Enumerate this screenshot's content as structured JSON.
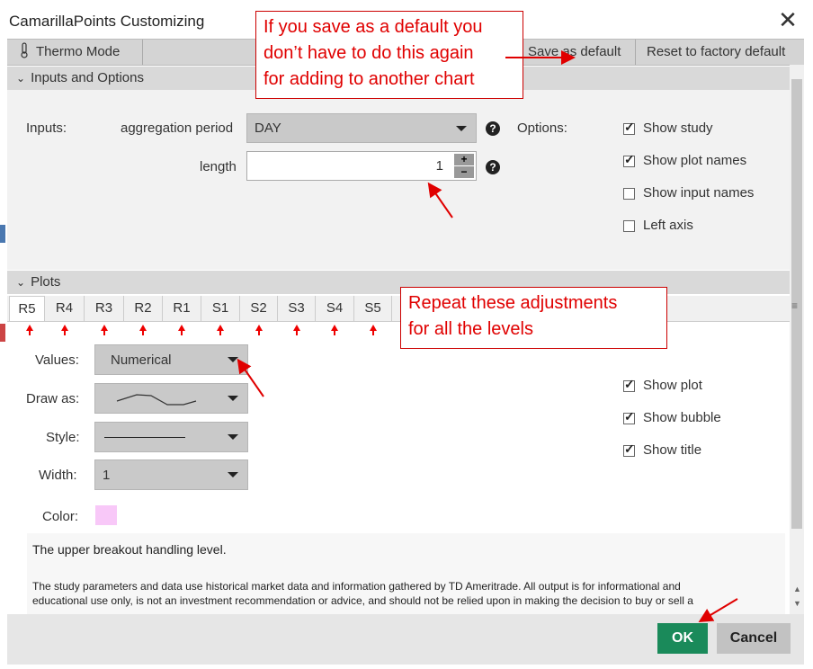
{
  "window": {
    "title": "CamarillaPoints Customizing",
    "close_glyph": "✕"
  },
  "toolbar": {
    "thermo_label": "Thermo Mode",
    "thermo_icon": "thermometer-icon",
    "save_default_label": "Save as default",
    "reset_label": "Reset to factory default"
  },
  "inputs_section": {
    "header": "Inputs and Options",
    "inputs_label": "Inputs:",
    "aggregation_label": "aggregation period",
    "aggregation_value": "DAY",
    "length_label": "length",
    "length_value": "1",
    "help_glyph": "?",
    "stepper_plus": "+",
    "stepper_minus": "−",
    "options_label": "Options:",
    "options": [
      {
        "label": "Show study",
        "checked": true
      },
      {
        "label": "Show plot names",
        "checked": true
      },
      {
        "label": "Show input names",
        "checked": false
      },
      {
        "label": "Left axis",
        "checked": false
      }
    ]
  },
  "plots_section": {
    "header": "Plots",
    "tabs": [
      "R5",
      "R4",
      "R3",
      "R2",
      "R1",
      "S1",
      "S2",
      "S3",
      "S4",
      "S5"
    ],
    "active_tab": "R5",
    "values_label": "Values:",
    "values_value": "Numerical",
    "draw_as_label": "Draw as:",
    "style_label": "Style:",
    "width_label": "Width:",
    "width_value": "1",
    "color_label": "Color:",
    "color_swatch": "#f8c8f8",
    "right_options": [
      {
        "label": "Show plot",
        "checked": true
      },
      {
        "label": "Show bubble",
        "checked": true
      },
      {
        "label": "Show title",
        "checked": true
      }
    ]
  },
  "description": {
    "summary": "The upper breakout handling level.",
    "disclaimer_line1": "The study parameters and data use historical market data and information gathered by TD Ameritrade. All output is for informational and",
    "disclaimer_line2": "educational use only, is not an investment recommendation or advice, and should not be relied upon in making the decision to buy or sell a"
  },
  "footer": {
    "ok_label": "OK",
    "cancel_label": "Cancel"
  },
  "annotations": {
    "callout_top_line1": "If you save as a default you",
    "callout_top_line2": "don’t have to do this again",
    "callout_top_line3": "for adding to another chart",
    "callout_mid_line1": "Repeat these adjustments",
    "callout_mid_line2": "for all the levels",
    "color": "#e00000"
  },
  "scrollbar": {
    "up_glyph": "▲",
    "down_glyph": "▼",
    "grip_glyph": "≡"
  }
}
